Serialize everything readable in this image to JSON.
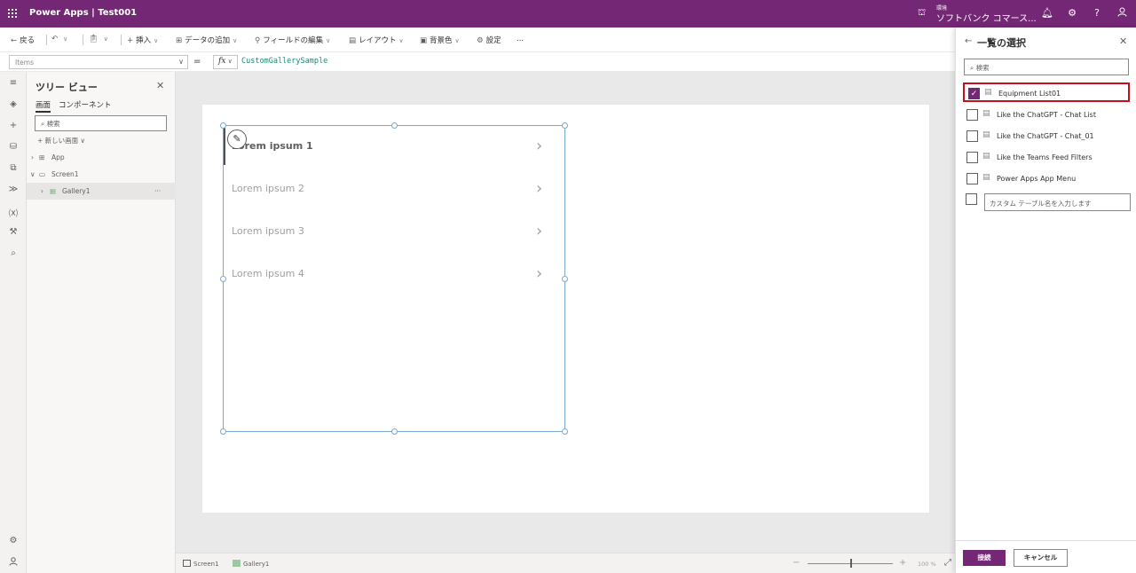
{
  "app": {
    "title": "Power Apps | Test001",
    "environment_label": "環境",
    "environment_name": "ソフトバンク コマース..."
  },
  "topbar_icons": [
    "environment-icon",
    "bell-icon",
    "gear-icon",
    "help-icon",
    "user-icon"
  ],
  "toolbar": {
    "back": "戻る",
    "insert": "挿入",
    "add_data": "データの追加",
    "edit_fields": "フィールドの編集",
    "layout": "レイアウト",
    "background": "背景色",
    "settings": "設定",
    "more": "..."
  },
  "formula": {
    "property": "Items",
    "equals": "=",
    "fx": "fx",
    "value": "CustomGallerySample"
  },
  "tree": {
    "title": "ツリー ビュー",
    "tab_screens": "画面",
    "tab_components": "コンポーネント",
    "search_placeholder": "検索",
    "new_screen": "新しい画面",
    "nodes": {
      "app": "App",
      "screen1": "Screen1",
      "gallery1": "Gallery1"
    }
  },
  "gallery": {
    "items": [
      "Lorem ipsum 1",
      "Lorem ipsum 2",
      "Lorem ipsum 3",
      "Lorem ipsum 4"
    ]
  },
  "statusbar": {
    "screen": "Screen1",
    "gallery": "Gallery1",
    "zoom_minus": "−",
    "zoom_plus": "+",
    "zoom": "100 %"
  },
  "panel": {
    "title": "一覧の選択",
    "search_placeholder": "検索",
    "lists": [
      {
        "label": "Equipment List01",
        "checked": true
      },
      {
        "label": "Like the ChatGPT - Chat List",
        "checked": false
      },
      {
        "label": "Like the ChatGPT - Chat_01",
        "checked": false
      },
      {
        "label": "Like the Teams Feed Filters",
        "checked": false
      },
      {
        "label": "Power Apps App Menu",
        "checked": false
      }
    ],
    "custom_placeholder": "カスタム テーブル名を入力します",
    "connect": "接続",
    "cancel": "キャンセル"
  },
  "colors": {
    "brand": "#742774",
    "highlight": "#c50f1f"
  }
}
